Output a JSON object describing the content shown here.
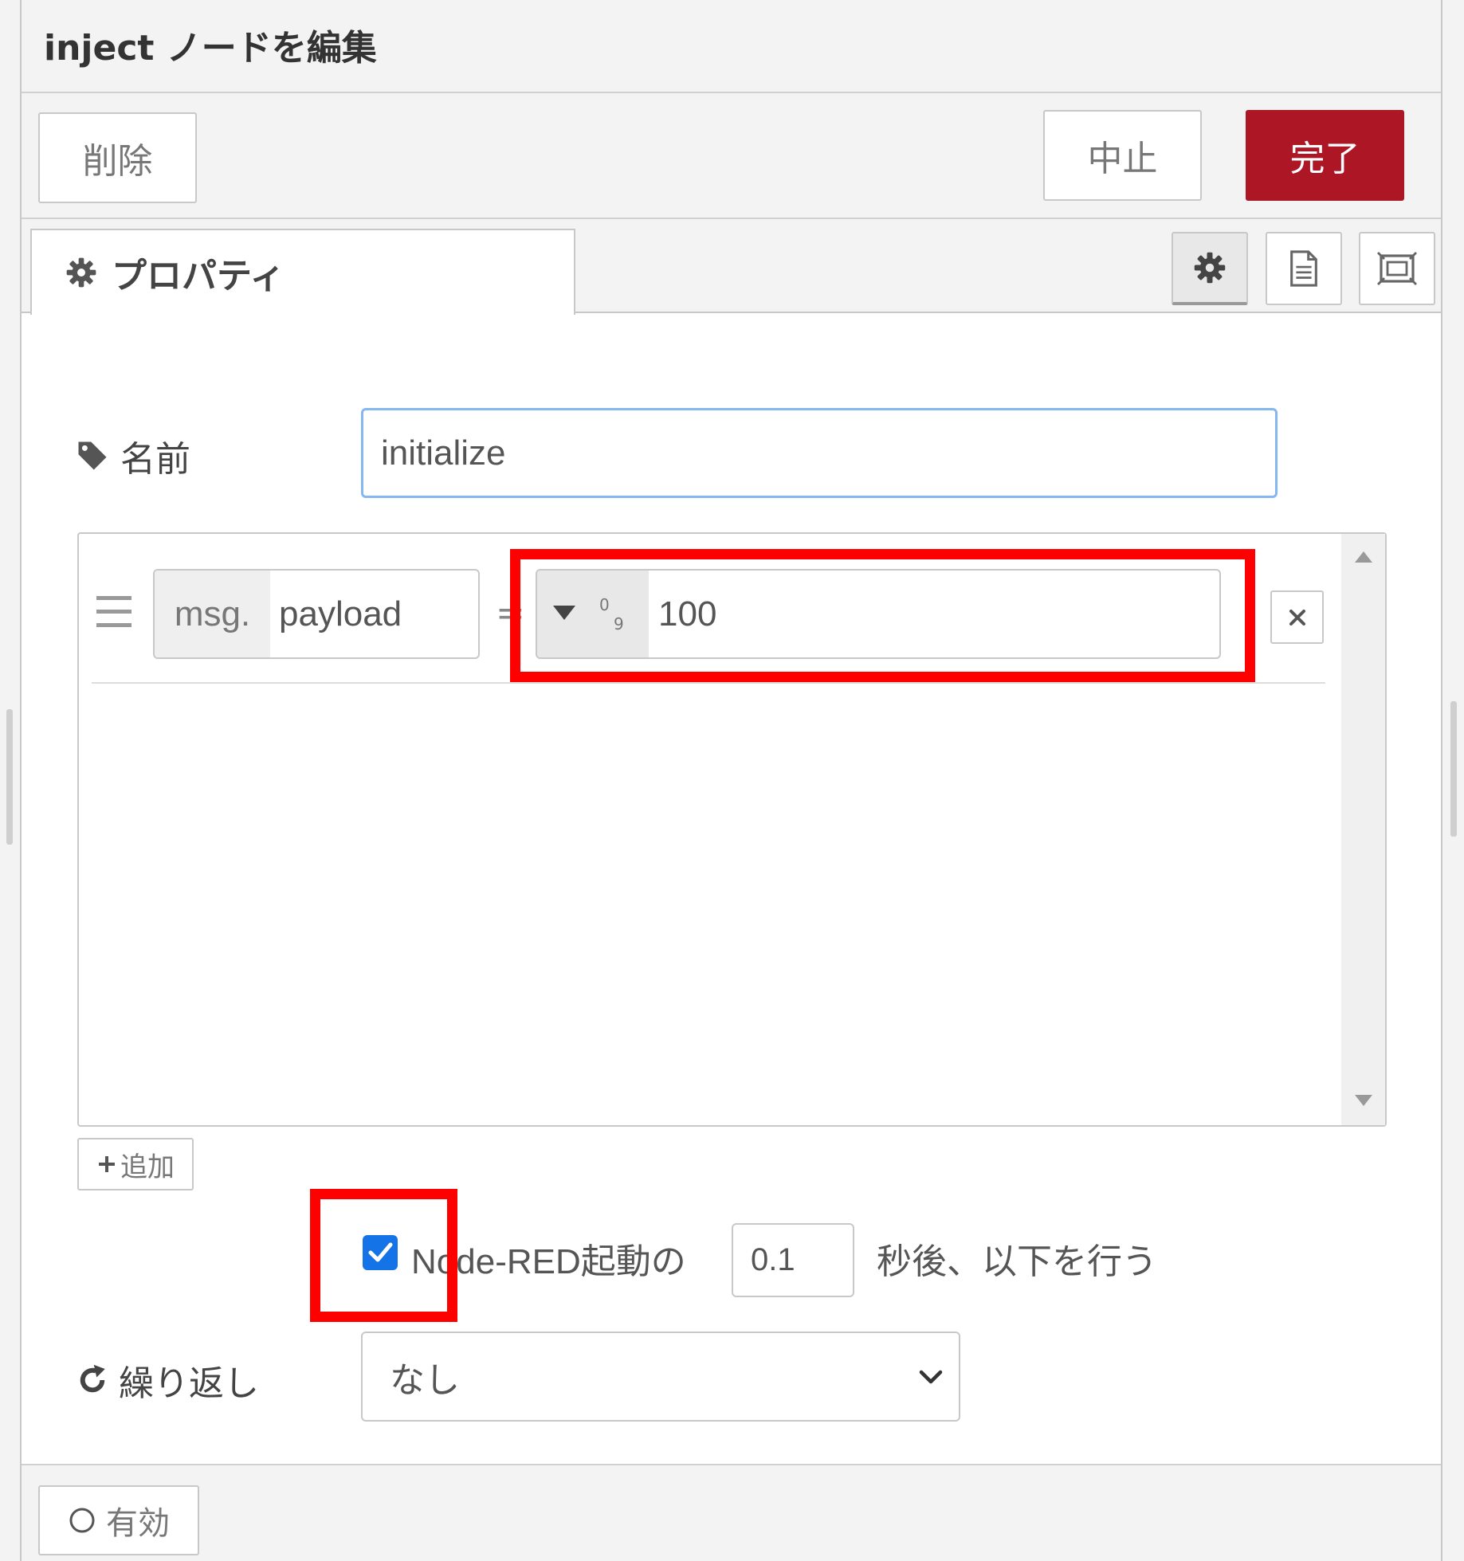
{
  "dialog": {
    "title": "inject ノードを編集"
  },
  "toolbar": {
    "delete_label": "削除",
    "cancel_label": "中止",
    "done_label": "完了",
    "done_color": "#ad1625"
  },
  "tabs": {
    "properties_label": "プロパティ",
    "icons": [
      "gear-icon",
      "document-icon",
      "frame-icon"
    ]
  },
  "form": {
    "name_label": "名前",
    "name_value": "initialize",
    "property_rows": [
      {
        "prefix": "msg.",
        "property": "payload",
        "operator": "=",
        "type_icon": "number-type-icon",
        "value": "100"
      }
    ],
    "add_label": "追加",
    "onstart_checked": true,
    "onstart_label": "Node-RED起動の",
    "onstart_delay": "0.1",
    "onstart_suffix": "秒後、以下を行う",
    "repeat_label": "繰り返し",
    "repeat_value": "なし"
  },
  "footer": {
    "enabled_label": "有効"
  },
  "colors": {
    "highlight": "#ff0000",
    "checkbox": "#1473e6",
    "input_focus_border": "#85b7f0"
  }
}
